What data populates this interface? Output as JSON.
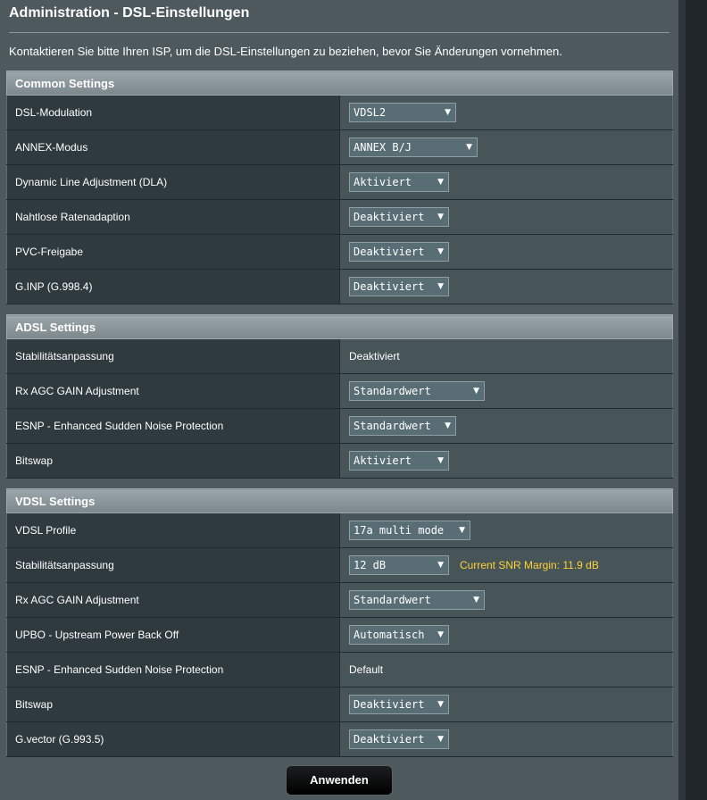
{
  "title": "Administration - DSL-Einstellungen",
  "description": "Kontaktieren Sie bitte Ihren ISP, um die DSL-Einstellungen zu beziehen, bevor Sie Änderungen vornehmen.",
  "common": {
    "header": "Common Settings",
    "dsl_modulation": {
      "label": "DSL-Modulation",
      "value": "VDSL2"
    },
    "annex_mode": {
      "label": "ANNEX-Modus",
      "value": "ANNEX B/J"
    },
    "dla": {
      "label": "Dynamic Line Adjustment (DLA)",
      "value": "Aktiviert"
    },
    "seamless_rate": {
      "label": "Nahtlose Ratenadaption",
      "value": "Deaktiviert"
    },
    "pvc_release": {
      "label": "PVC-Freigabe",
      "value": "Deaktiviert"
    },
    "ginp": {
      "label": "G.INP (G.998.4)",
      "value": "Deaktiviert"
    }
  },
  "adsl": {
    "header": "ADSL Settings",
    "stability": {
      "label": "Stabilitätsanpassung",
      "value": "Deaktiviert"
    },
    "rx_agc": {
      "label": "Rx AGC GAIN Adjustment",
      "value": "Standardwert"
    },
    "esnp": {
      "label": "ESNP - Enhanced Sudden Noise Protection",
      "value": "Standardwert"
    },
    "bitswap": {
      "label": "Bitswap",
      "value": "Aktiviert"
    }
  },
  "vdsl": {
    "header": "VDSL Settings",
    "profile": {
      "label": "VDSL Profile",
      "value": "17a multi mode"
    },
    "stability": {
      "label": "Stabilitätsanpassung",
      "value": "12 dB",
      "snr_note": "Current SNR Margin: 11.9 dB"
    },
    "rx_agc": {
      "label": "Rx AGC GAIN Adjustment",
      "value": "Standardwert"
    },
    "upbo": {
      "label": "UPBO - Upstream Power Back Off",
      "value": "Automatisch"
    },
    "esnp": {
      "label": "ESNP - Enhanced Sudden Noise Protection",
      "value": "Default"
    },
    "bitswap": {
      "label": "Bitswap",
      "value": "Deaktiviert"
    },
    "gvector": {
      "label": "G.vector (G.993.5)",
      "value": "Deaktiviert"
    }
  },
  "apply_label": "Anwenden",
  "colors": {
    "snr_note": "#fcd235",
    "row_label_bg": "#2f3a3e",
    "row_value_bg": "#475458"
  }
}
